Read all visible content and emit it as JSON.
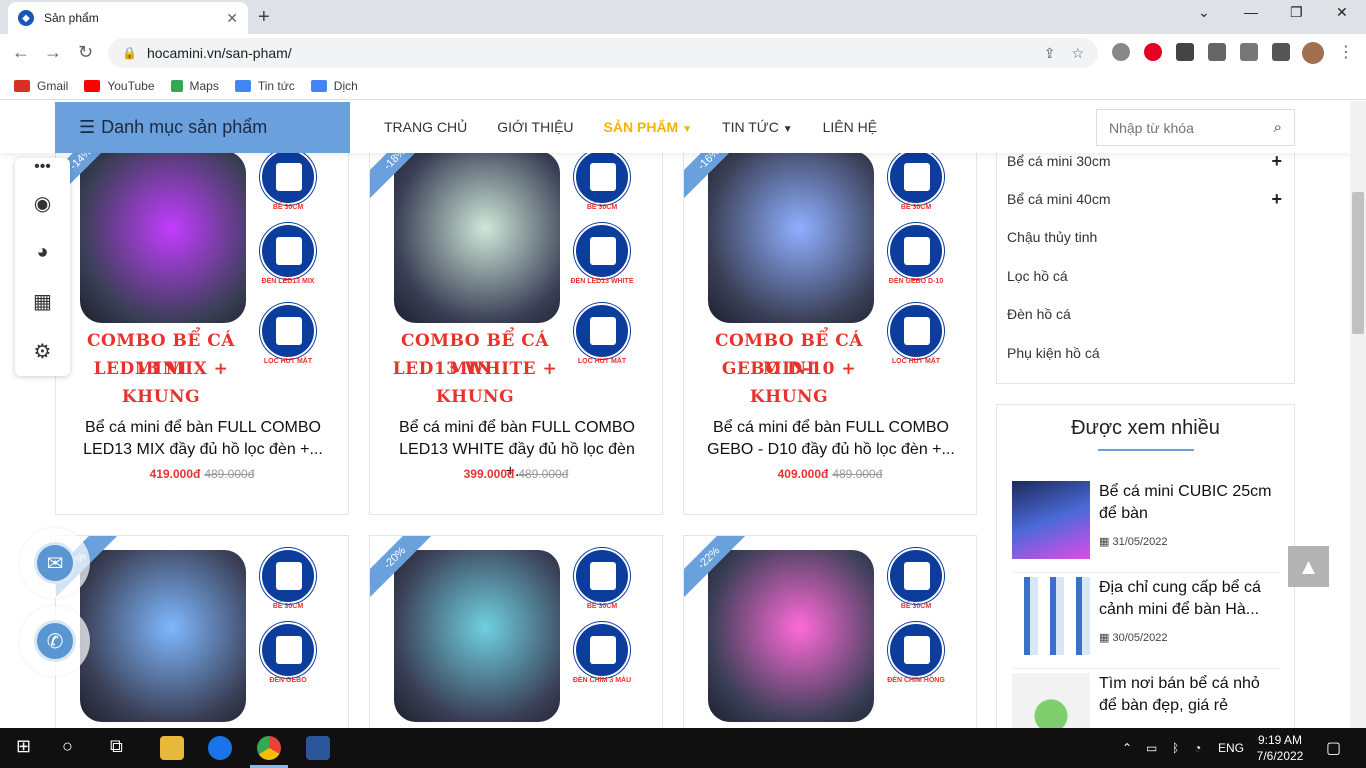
{
  "browser": {
    "tab_title": "Sản phẩm",
    "url": "hocamini.vn/san-pham/",
    "bookmarks": [
      {
        "label": "Gmail",
        "color": "#d93025"
      },
      {
        "label": "YouTube",
        "color": "#ff0000"
      },
      {
        "label": "Maps",
        "color": "#34a853"
      },
      {
        "label": "Tin tức",
        "color": "#4285f4"
      },
      {
        "label": "Dịch",
        "color": "#4285f4"
      }
    ]
  },
  "site": {
    "category_button": "Danh mục sản phẩm",
    "menu": [
      "TRANG CHỦ",
      "GIỚI THIỆU",
      "SẢN PHẨM",
      "TIN TỨC",
      "LIÊN HỆ"
    ],
    "search_placeholder": "Nhập từ khóa",
    "accent": "#6aa1dc",
    "active_menu_color": "#f3b300",
    "price_color": "#e8322d"
  },
  "products": [
    {
      "discount": "-14%",
      "combo1": "COMBO BỂ CÁ MINI",
      "combo2": "LED13 MIX + KHUNG",
      "labels": [
        "BỂ 30CM",
        "ĐÈN LED13 MIX",
        "LỌC HÚT MẶT"
      ],
      "name": "Bể cá mini để bàn FULL COMBO LED13 MIX đầy đủ hồ lọc đèn +...",
      "price": "419.000đ",
      "old": "489.000đ",
      "glow": "#c23cff"
    },
    {
      "discount": "-18%",
      "combo1": "COMBO BỂ CÁ MINI",
      "combo2": "LED13 WHITE + KHUNG",
      "labels": [
        "BỂ 30CM",
        "ĐÈN LED13 WHITE",
        "LỌC HÚT MẶT"
      ],
      "name": "Bể cá mini để bàn FULL COMBO LED13 WHITE đầy đủ hồ lọc đèn +...",
      "price": "399.000đ",
      "old": "489.000đ",
      "glow": "#cfe8d8"
    },
    {
      "discount": "-16%",
      "combo1": "COMBO BỂ CÁ MINI",
      "combo2": "GEBO D-10 + KHUNG",
      "labels": [
        "BỂ 30CM",
        "ĐÈN GEBO D-10",
        "LỌC HÚT MẶT"
      ],
      "name": "Bể cá mini để bàn FULL COMBO GEBO - D10 đầy đủ hồ lọc đèn +...",
      "price": "409.000đ",
      "old": "489.000đ",
      "glow": "#8fb0ff"
    },
    {
      "discount": "%",
      "labels": [
        "BỂ 30CM",
        "ĐÈN GEBO"
      ],
      "glow": "#7fb8ff"
    },
    {
      "discount": "-20%",
      "labels": [
        "BỂ 30CM",
        "ĐÈN CHÌM 3 MÀU"
      ],
      "glow": "#6fd0e0"
    },
    {
      "discount": "-22%",
      "labels": [
        "BỂ 30CM",
        "ĐÈN CHÌM HỒNG"
      ],
      "glow": "#ff6ad8"
    }
  ],
  "sidebar": {
    "categories": [
      {
        "label": "Bể cá mini 30cm",
        "plus": "+"
      },
      {
        "label": "Bể cá mini 40cm",
        "plus": "+"
      },
      {
        "label": "Chậu thủy tinh"
      },
      {
        "label": "Lọc hồ cá"
      },
      {
        "label": "Đèn hồ cá"
      },
      {
        "label": "Phụ kiện hồ cá"
      }
    ],
    "viewed_title": "Được xem nhiều",
    "viewed": [
      {
        "title": "Bể cá mini CUBIC 25cm để bàn",
        "date": "31/05/2022"
      },
      {
        "title": "Địa chỉ cung cấp bể cá cảnh mini để bàn Hà...",
        "date": "30/05/2022"
      },
      {
        "title": "Tìm nơi bán bể cá nhỏ để bàn đẹp, giá rẻ",
        "date": ""
      }
    ]
  },
  "taskbar": {
    "time": "9:19 AM",
    "date": "7/6/2022",
    "lang": "ENG"
  }
}
